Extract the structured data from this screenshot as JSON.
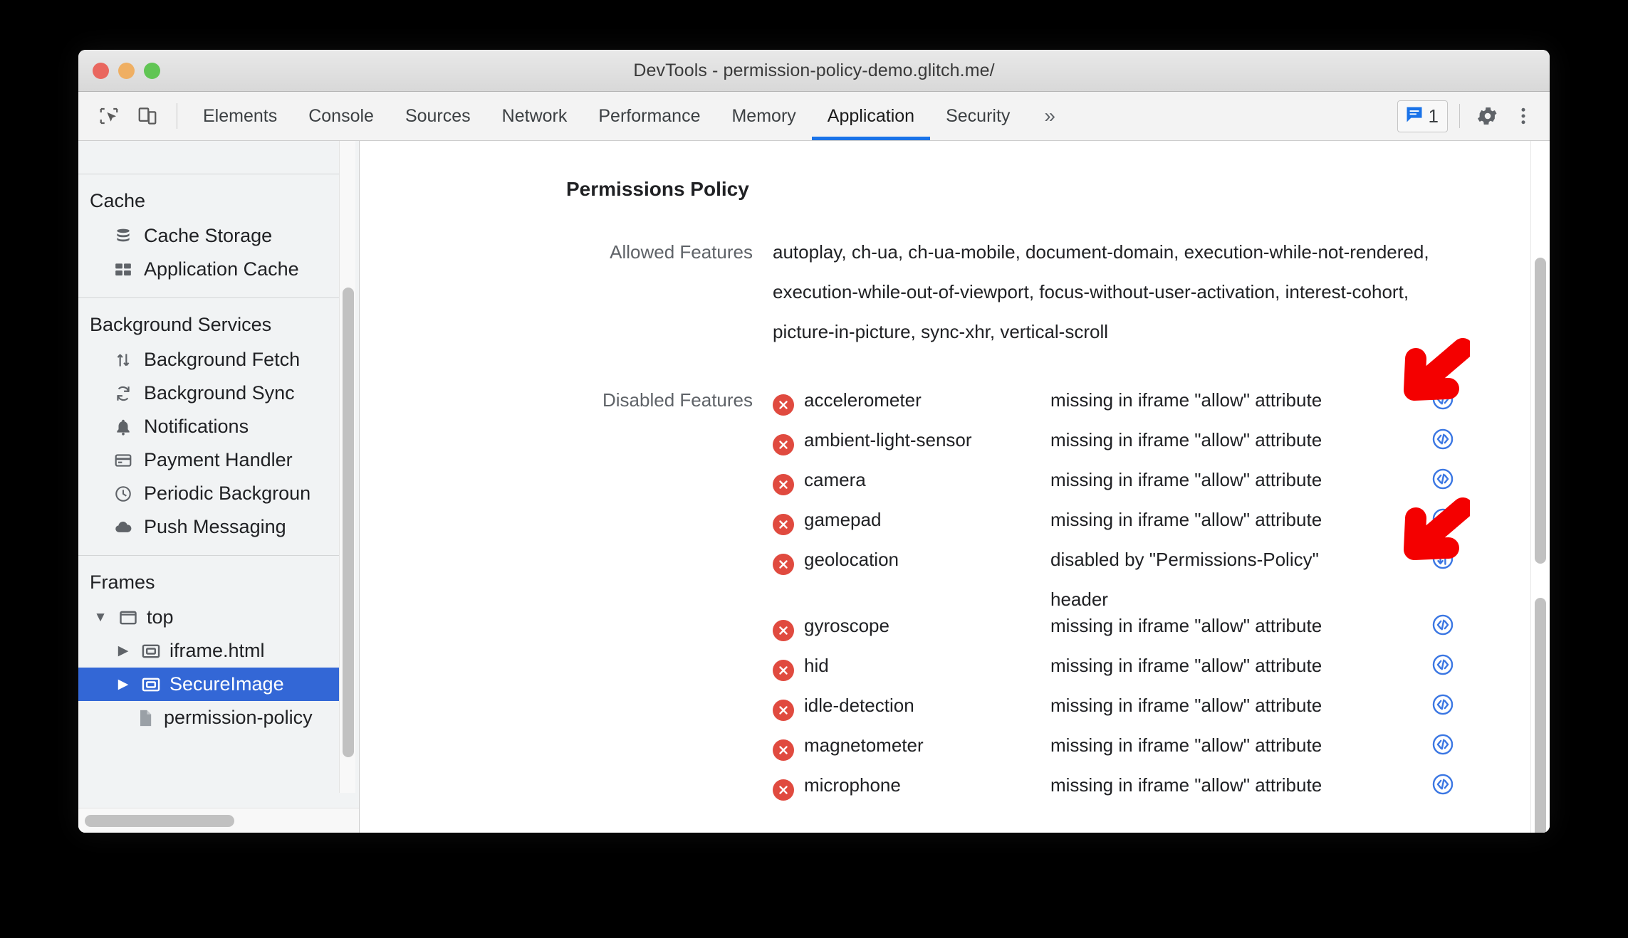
{
  "window": {
    "title": "DevTools - permission-policy-demo.glitch.me/",
    "traffic_lights": [
      "close-button",
      "minimize-button",
      "zoom-button"
    ]
  },
  "toolbar": {
    "inspect_icon": "inspect-element-icon",
    "device_icon": "device-toolbar-icon",
    "tabs": [
      {
        "label": "Elements",
        "active": false
      },
      {
        "label": "Console",
        "active": false
      },
      {
        "label": "Sources",
        "active": false
      },
      {
        "label": "Network",
        "active": false
      },
      {
        "label": "Performance",
        "active": false
      },
      {
        "label": "Memory",
        "active": false
      },
      {
        "label": "Application",
        "active": true
      },
      {
        "label": "Security",
        "active": false
      }
    ],
    "more_tabs_label": "»",
    "message_count": "1",
    "message_icon": "message-icon",
    "settings_icon": "gear-icon",
    "menu_icon": "more-vertical-icon",
    "active_tab_underline_color": "#1a73e8"
  },
  "sidebar": {
    "sections": [
      {
        "title": "Cache",
        "items": [
          {
            "label": "Cache Storage",
            "icon": "database-icon"
          },
          {
            "label": "Application Cache",
            "icon": "grid-icon"
          }
        ]
      },
      {
        "title": "Background Services",
        "items": [
          {
            "label": "Background Fetch",
            "icon": "up-down-arrows-icon"
          },
          {
            "label": "Background Sync",
            "icon": "sync-icon"
          },
          {
            "label": "Notifications",
            "icon": "bell-icon"
          },
          {
            "label": "Payment Handler",
            "icon": "credit-card-icon"
          },
          {
            "label": "Periodic Backgroun",
            "icon": "clock-icon"
          },
          {
            "label": "Push Messaging",
            "icon": "cloud-icon"
          }
        ]
      }
    ],
    "frames": {
      "title": "Frames",
      "tree": [
        {
          "label": "top",
          "icon": "frame-icon",
          "twisty": "▼",
          "depth": 1,
          "selected": false
        },
        {
          "label": "iframe.html",
          "icon": "iframe-icon",
          "twisty": "▶",
          "depth": 2,
          "selected": false
        },
        {
          "label": "SecureImage",
          "icon": "iframe-icon",
          "twisty": "▶",
          "depth": 2,
          "selected": true
        },
        {
          "label": "permission-policy",
          "icon": "document-icon",
          "twisty": "",
          "depth": 3,
          "selected": false
        }
      ]
    },
    "selection_color": "#3367d6"
  },
  "main": {
    "title": "Permissions Policy",
    "allowed": {
      "label": "Allowed Features",
      "lines": [
        "autoplay, ch-ua, ch-ua-mobile, document-domain, execution-while-not-rendered,",
        "execution-while-out-of-viewport, focus-without-user-activation, interest-cohort,",
        "picture-in-picture, sync-xhr, vertical-scroll"
      ]
    },
    "disabled": {
      "label": "Disabled Features",
      "error_icon": "error-circle-icon",
      "rows": [
        {
          "name": "accelerometer",
          "reason": "missing in iframe \"allow\" attribute",
          "reason_line2": "",
          "action_icon": "code-circle-icon"
        },
        {
          "name": "ambient-light-sensor",
          "reason": "missing in iframe \"allow\" attribute",
          "reason_line2": "",
          "action_icon": "code-circle-icon"
        },
        {
          "name": "camera",
          "reason": "missing in iframe \"allow\" attribute",
          "reason_line2": "",
          "action_icon": "code-circle-icon"
        },
        {
          "name": "gamepad",
          "reason": "missing in iframe \"allow\" attribute",
          "reason_line2": "",
          "action_icon": "code-circle-icon"
        },
        {
          "name": "geolocation",
          "reason": "disabled by \"Permissions-Policy\"",
          "reason_line2": "header",
          "action_icon": "network-request-icon"
        },
        {
          "name": "gyroscope",
          "reason": "missing in iframe \"allow\" attribute",
          "reason_line2": "",
          "action_icon": "code-circle-icon"
        },
        {
          "name": "hid",
          "reason": "missing in iframe \"allow\" attribute",
          "reason_line2": "",
          "action_icon": "code-circle-icon"
        },
        {
          "name": "idle-detection",
          "reason": "missing in iframe \"allow\" attribute",
          "reason_line2": "",
          "action_icon": "code-circle-icon"
        },
        {
          "name": "magnetometer",
          "reason": "missing in iframe \"allow\" attribute",
          "reason_line2": "",
          "action_icon": "code-circle-icon"
        },
        {
          "name": "microphone",
          "reason": "missing in iframe \"allow\" attribute",
          "reason_line2": "",
          "action_icon": "code-circle-icon"
        }
      ]
    }
  },
  "annotations": {
    "color": "#f40000",
    "arrows": [
      {
        "name": "arrow-pointing-accelerometer-action-icon",
        "direction": "down-left"
      },
      {
        "name": "arrow-pointing-geolocation-action-icon",
        "direction": "down-left"
      }
    ]
  }
}
